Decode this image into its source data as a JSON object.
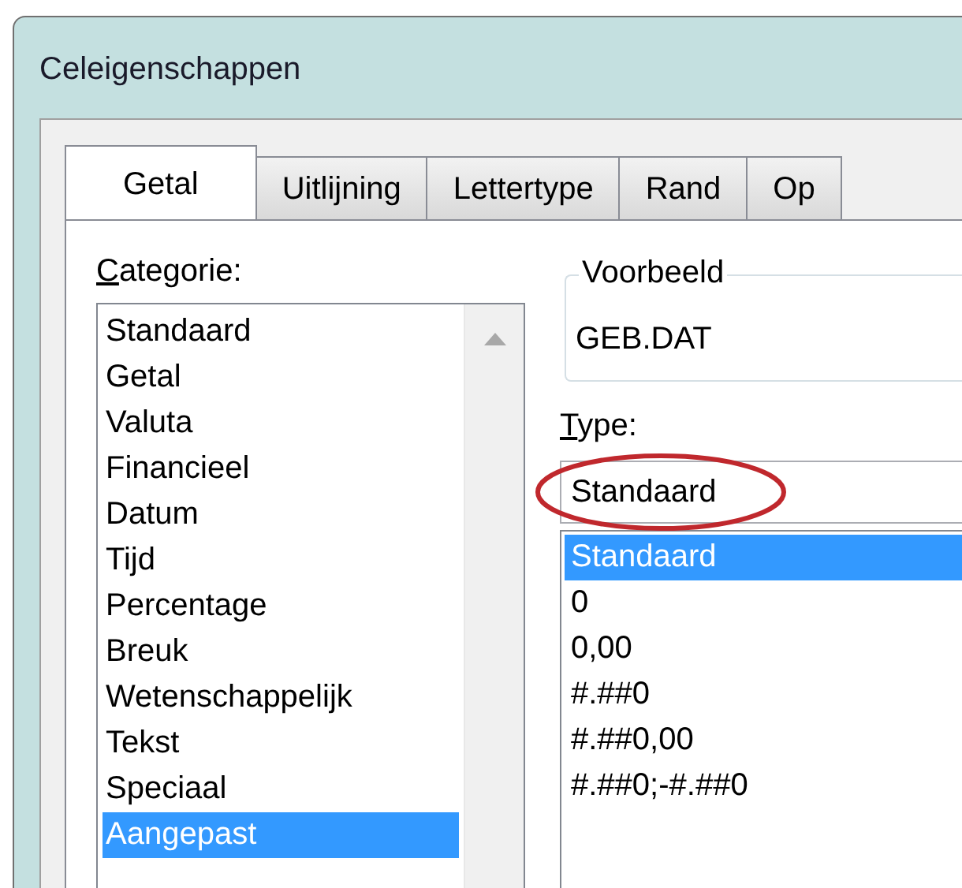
{
  "window": {
    "title": "Celeigenschappen"
  },
  "tabs": [
    {
      "label": "Getal",
      "selected": true
    },
    {
      "label": "Uitlijning",
      "selected": false
    },
    {
      "label": "Lettertype",
      "selected": false
    },
    {
      "label": "Rand",
      "selected": false
    },
    {
      "label": "Op",
      "selected": false
    }
  ],
  "category": {
    "label": "Categorie:",
    "items": [
      {
        "label": "Standaard",
        "selected": false
      },
      {
        "label": "Getal",
        "selected": false
      },
      {
        "label": "Valuta",
        "selected": false
      },
      {
        "label": "Financieel",
        "selected": false
      },
      {
        "label": "Datum",
        "selected": false
      },
      {
        "label": "Tijd",
        "selected": false
      },
      {
        "label": "Percentage",
        "selected": false
      },
      {
        "label": "Breuk",
        "selected": false
      },
      {
        "label": "Wetenschappelijk",
        "selected": false
      },
      {
        "label": "Tekst",
        "selected": false
      },
      {
        "label": "Speciaal",
        "selected": false
      },
      {
        "label": "Aangepast",
        "selected": true
      }
    ]
  },
  "preview": {
    "title": "Voorbeeld",
    "value": "GEB.DAT"
  },
  "type": {
    "label": "Type:",
    "value": "Standaard",
    "highlighted": true,
    "items": [
      {
        "label": "Standaard",
        "selected": true
      },
      {
        "label": "0",
        "selected": false
      },
      {
        "label": "0,00",
        "selected": false
      },
      {
        "label": "#.##0",
        "selected": false
      },
      {
        "label": "#.##0,00",
        "selected": false
      },
      {
        "label": "#.##0;-#.##0",
        "selected": false
      }
    ]
  }
}
